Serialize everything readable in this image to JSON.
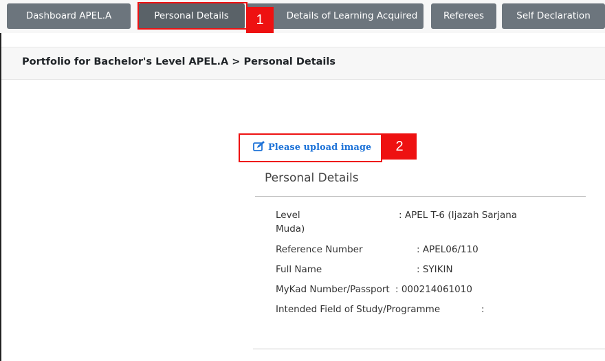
{
  "tabs": [
    {
      "label": "Dashboard APEL.A"
    },
    {
      "label": "Personal Details"
    },
    {
      "label": "Details of Learning Acquired"
    },
    {
      "label": "Referees"
    },
    {
      "label": "Self Declaration"
    }
  ],
  "markers": {
    "one": "1",
    "two": "2"
  },
  "breadcrumb": "Portfolio for Bachelor's Level APEL.A > Personal Details",
  "upload_link": "Please upload image",
  "section_title": "Personal Details",
  "details": {
    "level_label": "Level",
    "level_label_cont": "Muda)",
    "level_value": ": APEL T-6 (Ijazah Sarjana",
    "ref_label": "Reference Number",
    "ref_value": ": APEL06/110",
    "name_label": "Full Name",
    "name_value": ": SYIKIN",
    "mykad_label": "MyKad Number/Passport",
    "mykad_value": ": 000214061010",
    "field_label": "Intended Field of Study/Programme",
    "field_value": ":"
  },
  "colors": {
    "tab": "#6c757d",
    "link": "#1e73d8",
    "marker": "#ee1111"
  }
}
